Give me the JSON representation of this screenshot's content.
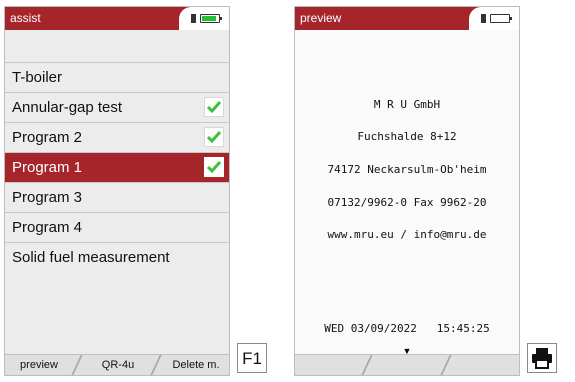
{
  "left_screen": {
    "title": "assist",
    "menu": [
      {
        "label": "T-boiler",
        "checked": false,
        "selected": false
      },
      {
        "label": "Annular-gap test",
        "checked": true,
        "selected": false
      },
      {
        "label": "Program 2",
        "checked": true,
        "selected": false
      },
      {
        "label": "Program 1",
        "checked": true,
        "selected": true
      },
      {
        "label": "Program 3",
        "checked": false,
        "selected": false
      },
      {
        "label": "Program 4",
        "checked": false,
        "selected": false
      },
      {
        "label": "Solid fuel measurement",
        "checked": false,
        "selected": false
      }
    ],
    "softkeys": [
      "preview",
      "QR-4u",
      "Delete m."
    ],
    "battery_level": 1.0,
    "battery_color": "#22c232"
  },
  "right_screen": {
    "title": "preview",
    "receipt_lines": [
      "M R U GmbH",
      "Fuchshalde 8+12",
      "74172 Neckarsulm-Ob'heim",
      "07132/9962-0 Fax 9962-20",
      "www.mru.eu / info@mru.de"
    ],
    "footer_line": "WED 03/09/2022   15:45:25",
    "battery_level": 0.0
  },
  "keys": {
    "f1_label": "F1",
    "print_icon": "printer-icon"
  },
  "colors": {
    "titlebar": "#a5252a",
    "check": "#3cc03c"
  }
}
